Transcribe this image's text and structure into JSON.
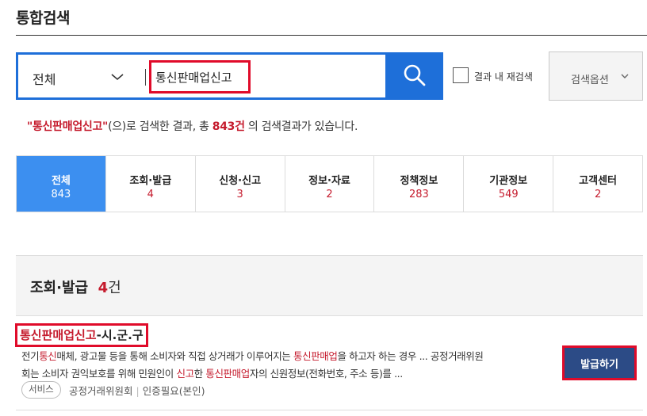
{
  "page_title": "통합검색",
  "search": {
    "scope": "전체",
    "query": "통신판매업신고",
    "placeholder": ""
  },
  "options": {
    "within_results_label": "결과 내 재검색",
    "within_results_checked": false,
    "search_options_label": "검색옵션"
  },
  "summary": {
    "keyword": "\"통신판매업신고\"",
    "text_before": "(으)로 검색한 결과, 총 ",
    "count": "843",
    "unit": "건",
    "text_after": " 의 검색결과가 있습니다."
  },
  "tabs": [
    {
      "label": "전체",
      "count": "843"
    },
    {
      "label": "조회·발급",
      "count": "4"
    },
    {
      "label": "신청·신고",
      "count": "3"
    },
    {
      "label": "정보·자료",
      "count": "2"
    },
    {
      "label": "정책정보",
      "count": "283"
    },
    {
      "label": "기관정보",
      "count": "549"
    },
    {
      "label": "고객센터",
      "count": "2"
    }
  ],
  "section": {
    "title": "조회·발급",
    "count": "4",
    "unit": "건"
  },
  "result": {
    "title_highlight": "통신판매업신고",
    "title_rest": "-시.군.구",
    "line1": [
      "전기",
      "통신",
      "매체, 광고물 등을 통해 소비자와 직접 상거래가 이루어지는 ",
      "통신판매업",
      "을 하고자 하는 경우 ... 공정거래위원"
    ],
    "line2": [
      "회는 소비자 권익보호를 위해 민원인이 ",
      "신고",
      "한 ",
      "통신판매업",
      "자의 신원정보(전화번호, 주소 등)를 ..."
    ],
    "tag": "서비스",
    "agency": "공정거래위원회",
    "auth": "인증필요(본인)",
    "issue_button": "발급하기"
  },
  "colors": {
    "accent_blue": "#1e6fd9",
    "tab_active": "#3c8ff0",
    "highlight_red": "#c51b2d",
    "annotation_red": "#e00b2a",
    "issue_button": "#2c4b86"
  },
  "icons": {
    "search_button": "search-icon",
    "scope_dropdown": "chevron-down-icon",
    "options_dropdown": "chevron-down-icon"
  }
}
